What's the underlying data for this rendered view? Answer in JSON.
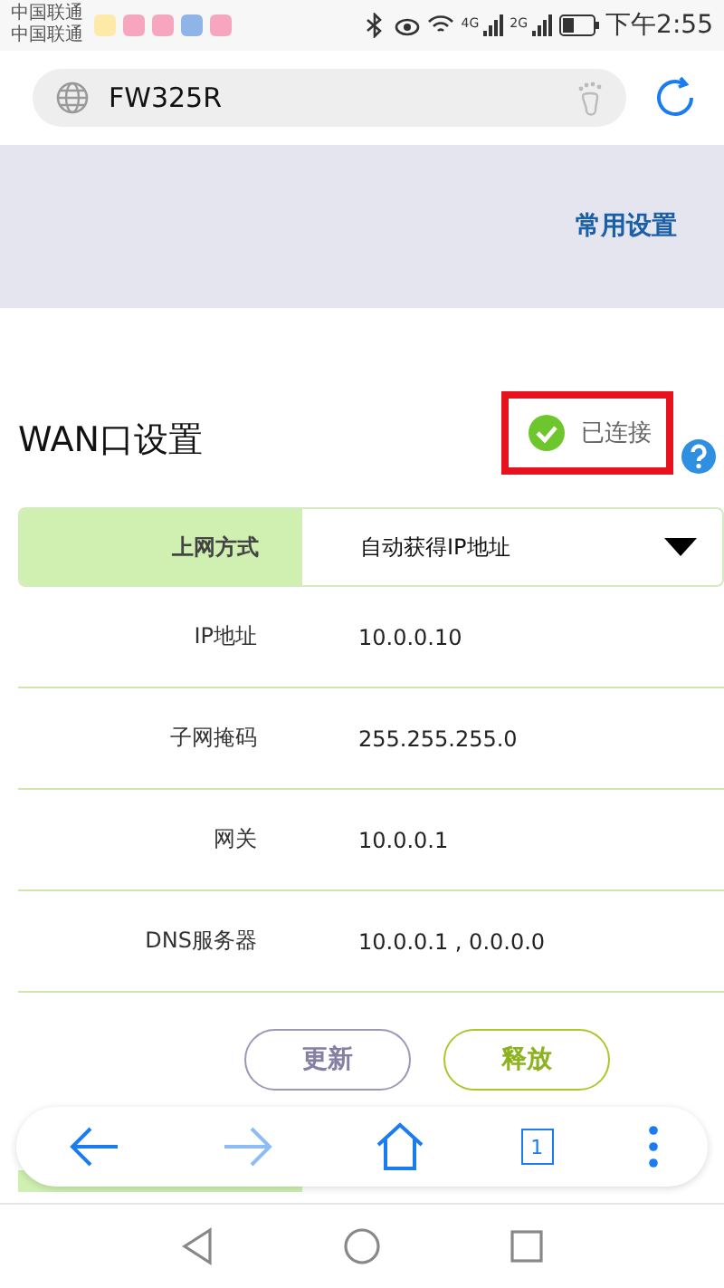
{
  "status_bar": {
    "carriers": [
      "中国联通",
      "中国联通"
    ],
    "network_1": "4G",
    "network_2": "2G",
    "time": "下午2:55"
  },
  "address_bar": {
    "value": "FW325R"
  },
  "header": {
    "link": "常用设置"
  },
  "section": {
    "title": "WAN口设置",
    "status": "已连接",
    "connected": true
  },
  "connection_type": {
    "label": "上网方式",
    "value": "自动获得IP地址"
  },
  "fields": [
    {
      "label": "IP地址",
      "value": "10.0.0.10"
    },
    {
      "label": "子网掩码",
      "value": "255.255.255.0"
    },
    {
      "label": "网关",
      "value": "10.0.0.1"
    },
    {
      "label": "DNS服务器",
      "value": "10.0.0.1 , 0.0.0.0"
    }
  ],
  "buttons": [
    {
      "label": "更新",
      "kind": "secondary"
    },
    {
      "label": "释放",
      "kind": "primary"
    }
  ],
  "toolbar": {
    "tab_count": "1"
  }
}
